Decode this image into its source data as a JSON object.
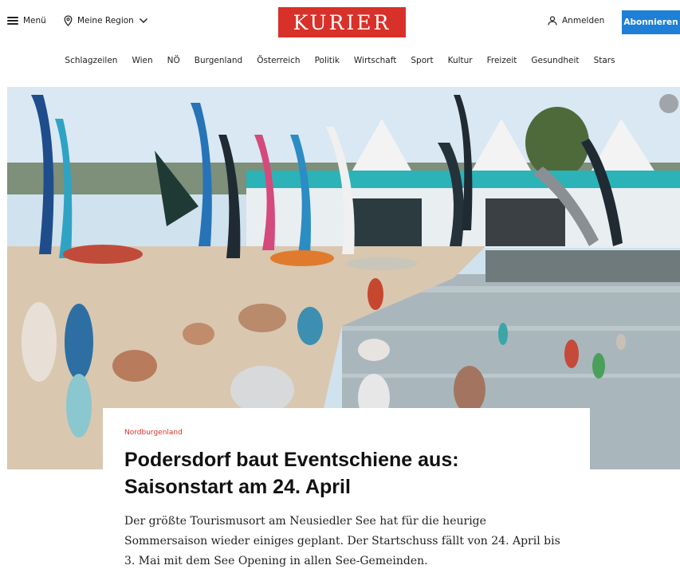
{
  "header": {
    "menu_label": "Menü",
    "region_label": "Meine Region",
    "logo_text": "KURIER",
    "login_label": "Anmelden",
    "subscribe_label": "Abonnieren"
  },
  "nav": {
    "items": [
      "Schlagzeilen",
      "Wien",
      "NÖ",
      "Burgenland",
      "Österreich",
      "Politik",
      "Wirtschaft",
      "Sport",
      "Kultur",
      "Freizeit",
      "Gesundheit",
      "Stars"
    ]
  },
  "article": {
    "kicker": "Nordburgenland",
    "headline": "Podersdorf baut Eventschiene aus: Saisonstart am 24. April",
    "teaser": "Der größte Tourismusort am Neusiedler See hat für die heurige Sommersaison wieder einiges geplant. Der Startschuss fällt von 24. April bis 3. Mai mit dem See Opening in allen See-Gemeinden."
  },
  "colors": {
    "brand_red": "#d8312a",
    "subscribe_blue": "#1e7fd6"
  },
  "icons": {
    "menu": "hamburger-icon",
    "region": "location-pin-icon",
    "region_chevron": "chevron-down-icon",
    "login": "user-icon",
    "gallery": "gallery-icon"
  }
}
